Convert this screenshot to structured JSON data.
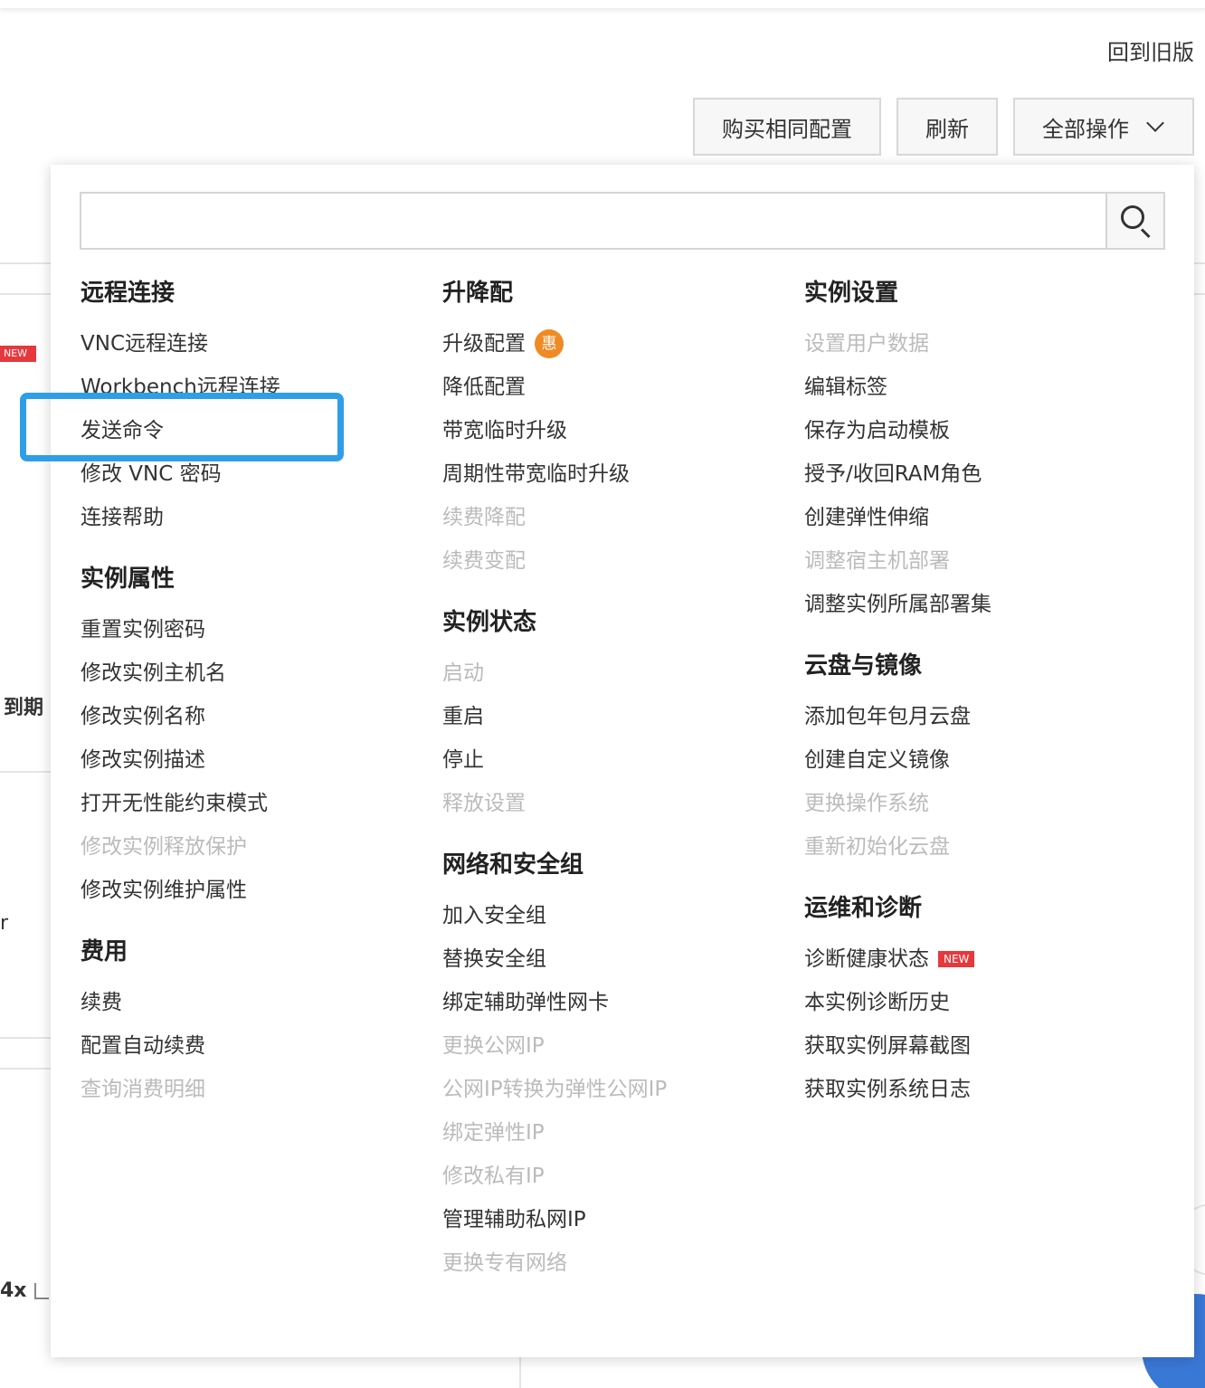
{
  "header": {
    "back_link": "回到旧版"
  },
  "toolbar": {
    "buy_same": "购买相同配置",
    "refresh": "刷新",
    "all_actions": "全部操作"
  },
  "background": {
    "new_badge": "NEW",
    "expire": "到期",
    "r_text": "r",
    "x_text": "4x"
  },
  "search": {
    "placeholder": "",
    "value": ""
  },
  "columns": [
    {
      "groups": [
        {
          "title": "远程连接",
          "items": [
            {
              "label": "VNC远程连接"
            },
            {
              "label": "Workbench远程连接"
            },
            {
              "label": "发送命令"
            },
            {
              "label": "修改 VNC 密码"
            },
            {
              "label": "连接帮助"
            }
          ]
        },
        {
          "title": "实例属性",
          "items": [
            {
              "label": "重置实例密码"
            },
            {
              "label": "修改实例主机名"
            },
            {
              "label": "修改实例名称"
            },
            {
              "label": "修改实例描述"
            },
            {
              "label": "打开无性能约束模式"
            },
            {
              "label": "修改实例释放保护"
            },
            {
              "label": "修改实例维护属性"
            }
          ]
        },
        {
          "title": "费用",
          "items": [
            {
              "label": "续费"
            },
            {
              "label": "配置自动续费"
            },
            {
              "label": "查询消费明细"
            }
          ]
        }
      ]
    },
    {
      "groups": [
        {
          "title": "升降配",
          "items": [
            {
              "label": "升级配置",
              "badge": "惠"
            },
            {
              "label": "降低配置"
            },
            {
              "label": "带宽临时升级"
            },
            {
              "label": "周期性带宽临时升级"
            },
            {
              "label": "续费降配"
            },
            {
              "label": "续费变配"
            }
          ]
        },
        {
          "title": "实例状态",
          "items": [
            {
              "label": "启动"
            },
            {
              "label": "重启"
            },
            {
              "label": "停止"
            },
            {
              "label": "释放设置"
            }
          ]
        },
        {
          "title": "网络和安全组",
          "items": [
            {
              "label": "加入安全组"
            },
            {
              "label": "替换安全组"
            },
            {
              "label": "绑定辅助弹性网卡"
            },
            {
              "label": "更换公网IP"
            },
            {
              "label": "公网IP转换为弹性公网IP"
            },
            {
              "label": "绑定弹性IP"
            },
            {
              "label": "修改私有IP"
            },
            {
              "label": "管理辅助私网IP"
            },
            {
              "label": "更换专有网络"
            }
          ]
        }
      ]
    },
    {
      "groups": [
        {
          "title": "实例设置",
          "items": [
            {
              "label": "设置用户数据"
            },
            {
              "label": "编辑标签"
            },
            {
              "label": "保存为启动模板"
            },
            {
              "label": "授予/收回RAM角色"
            },
            {
              "label": "创建弹性伸缩"
            },
            {
              "label": "调整宿主机部署"
            },
            {
              "label": "调整实例所属部署集"
            }
          ]
        },
        {
          "title": "云盘与镜像",
          "items": [
            {
              "label": "添加包年包月云盘"
            },
            {
              "label": "创建自定义镜像"
            },
            {
              "label": "更换操作系统"
            },
            {
              "label": "重新初始化云盘"
            }
          ]
        },
        {
          "title": "运维和诊断",
          "items": [
            {
              "label": "诊断健康状态",
              "badge": "NEW"
            },
            {
              "label": "本实例诊断历史"
            },
            {
              "label": "获取实例屏幕截图"
            },
            {
              "label": "获取实例系统日志"
            }
          ]
        }
      ]
    }
  ]
}
